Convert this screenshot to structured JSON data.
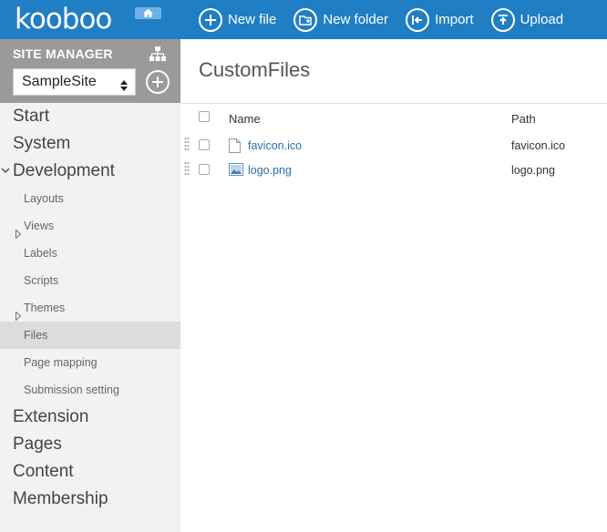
{
  "brand": {
    "logo_text": "kooboo",
    "home_icon": "home-icon"
  },
  "toolbar": [
    {
      "name": "new-file-button",
      "label": "New file",
      "icon": "plus-circle-icon"
    },
    {
      "name": "new-folder-button",
      "label": "New folder",
      "icon": "folder-plus-icon"
    },
    {
      "name": "import-button",
      "label": "Import",
      "icon": "import-icon"
    },
    {
      "name": "upload-button",
      "label": "Upload",
      "icon": "upload-icon"
    }
  ],
  "site_manager": {
    "title": "SITE MANAGER",
    "selected_site": "SampleSite"
  },
  "nav": {
    "start": "Start",
    "system": "System",
    "development": "Development",
    "development_items": {
      "layouts": "Layouts",
      "views": "Views",
      "labels": "Labels",
      "scripts": "Scripts",
      "themes": "Themes",
      "files": "Files",
      "page_mapping": "Page mapping",
      "submission_setting": "Submission setting"
    },
    "extension": "Extension",
    "pages": "Pages",
    "content": "Content",
    "membership": "Membership"
  },
  "main": {
    "title": "CustomFiles",
    "columns": {
      "name": "Name",
      "path": "Path"
    },
    "files": [
      {
        "name": "favicon.ico",
        "path": "favicon.ico",
        "icon": "file-icon"
      },
      {
        "name": "logo.png",
        "path": "logo.png",
        "icon": "image-icon"
      }
    ]
  }
}
